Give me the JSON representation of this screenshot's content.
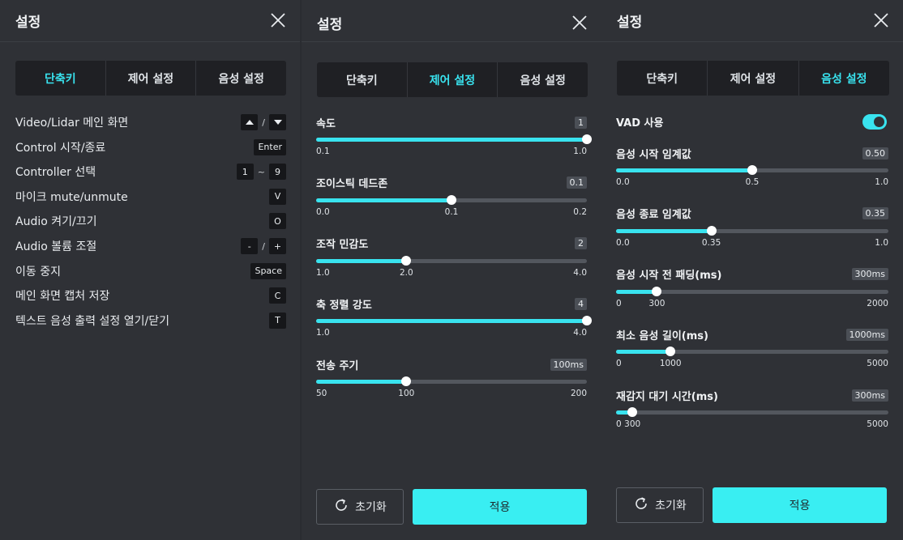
{
  "title": "설정",
  "tabs": [
    "단축키",
    "제어 설정",
    "음성 설정"
  ],
  "shortcuts": [
    {
      "label": "Video/Lidar 메인 화면",
      "keys": [
        "up-arrow-icon",
        "/",
        "down-arrow-icon"
      ]
    },
    {
      "label": "Control 시작/종료",
      "keys": [
        "Enter"
      ]
    },
    {
      "label": "Controller 선택",
      "keys": [
        "1",
        "~",
        "9"
      ]
    },
    {
      "label": "마이크 mute/unmute",
      "keys": [
        "V"
      ]
    },
    {
      "label": "Audio 켜기/끄기",
      "keys": [
        "O"
      ]
    },
    {
      "label": "Audio 볼륨 조절",
      "keys": [
        "-",
        "/",
        "+"
      ]
    },
    {
      "label": "이동 중지",
      "keys": [
        "Space"
      ]
    },
    {
      "label": "메인 화면 캡처 저장",
      "keys": [
        "C"
      ]
    },
    {
      "label": "텍스트 음성 출력 설정 열기/닫기",
      "keys": [
        "T"
      ]
    }
  ],
  "control_sliders": [
    {
      "label": "속도",
      "badge": "1",
      "min": 0.1,
      "max": 1.0,
      "value": 1.0,
      "ticks": [
        "0.1",
        "1.0"
      ],
      "tick_values": [
        0.1,
        1.0
      ]
    },
    {
      "label": "조이스틱 데드존",
      "badge": "0.1",
      "min": 0.0,
      "max": 0.2,
      "value": 0.1,
      "ticks": [
        "0.0",
        "0.1",
        "0.2"
      ],
      "tick_values": [
        0.0,
        0.1,
        0.2
      ]
    },
    {
      "label": "조작 민감도",
      "badge": "2",
      "min": 1.0,
      "max": 4.0,
      "value": 2.0,
      "ticks": [
        "1.0",
        "2.0",
        "4.0"
      ],
      "tick_values": [
        1.0,
        2.0,
        4.0
      ]
    },
    {
      "label": "축 정렬 강도",
      "badge": "4",
      "min": 1.0,
      "max": 4.0,
      "value": 4.0,
      "ticks": [
        "1.0",
        "4.0"
      ],
      "tick_values": [
        1.0,
        4.0
      ]
    },
    {
      "label": "전송 주기",
      "badge": "100ms",
      "min": 50,
      "max": 200,
      "value": 100,
      "ticks": [
        "50",
        "100",
        "200"
      ],
      "tick_values": [
        50,
        100,
        200
      ]
    }
  ],
  "voice": {
    "vad_label": "VAD 사용",
    "vad_enabled": true
  },
  "voice_sliders": [
    {
      "label": "음성 시작 임계값",
      "badge": "0.50",
      "min": 0.0,
      "max": 1.0,
      "value": 0.5,
      "ticks": [
        "0.0",
        "0.5",
        "1.0"
      ],
      "tick_values": [
        0.0,
        0.5,
        1.0
      ]
    },
    {
      "label": "음성 종료 임계값",
      "badge": "0.35",
      "min": 0.0,
      "max": 1.0,
      "value": 0.35,
      "ticks": [
        "0.0",
        "0.35",
        "1.0"
      ],
      "tick_values": [
        0.0,
        0.35,
        1.0
      ]
    },
    {
      "label": "음성 시작 전 패딩(ms)",
      "badge": "300ms",
      "min": 0,
      "max": 2000,
      "value": 300,
      "ticks": [
        "0",
        "300",
        "2000"
      ],
      "tick_values": [
        0,
        300,
        2000
      ]
    },
    {
      "label": "최소 음성 길이(ms)",
      "badge": "1000ms",
      "min": 0,
      "max": 5000,
      "value": 1000,
      "ticks": [
        "0",
        "1000",
        "5000"
      ],
      "tick_values": [
        0,
        1000,
        5000
      ]
    },
    {
      "label": "재감지 대기 시간(ms)",
      "badge": "300ms",
      "min": 0,
      "max": 5000,
      "value": 300,
      "ticks": [
        "0",
        "300",
        "5000"
      ],
      "tick_values": [
        0,
        300,
        5000
      ]
    }
  ],
  "footer": {
    "reset_label": "초기화",
    "apply_label": "적용"
  },
  "colors": {
    "accent": "#39e3ef",
    "panel_bg": "#2f3136",
    "key_bg": "#16171a"
  }
}
